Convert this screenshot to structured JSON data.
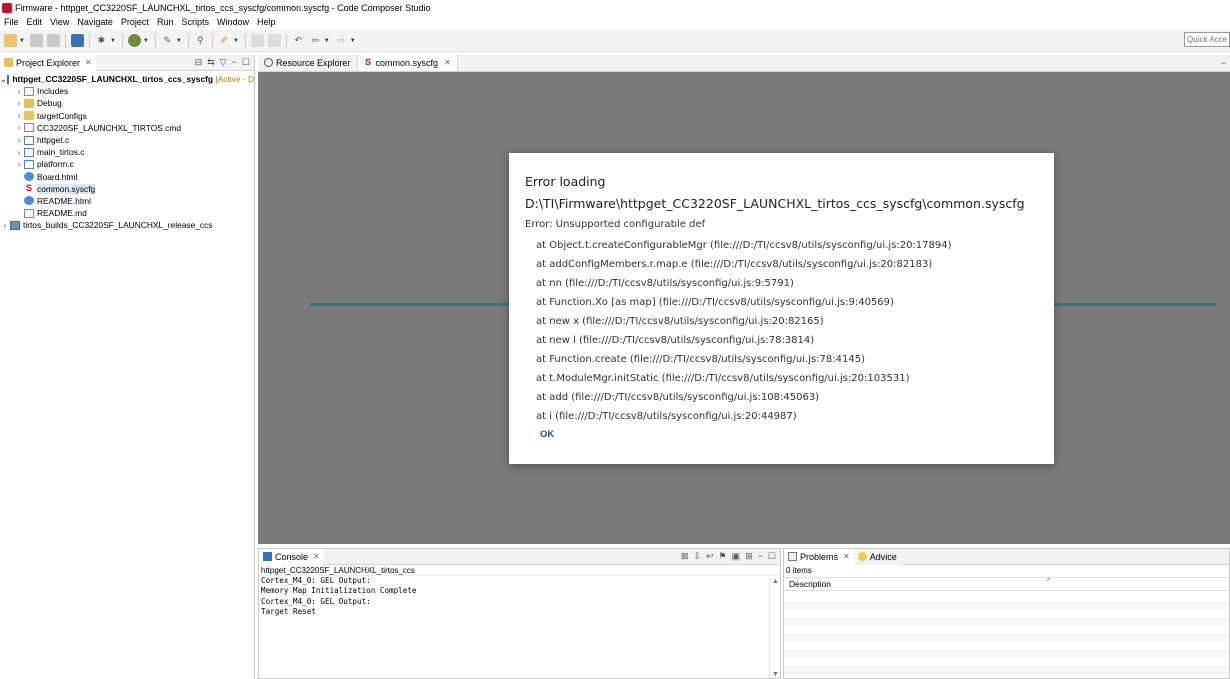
{
  "window": {
    "title": "Firmware - httpget_CC3220SF_LAUNCHXL_tirtos_ccs_syscfg/common.syscfg - Code Composer Studio"
  },
  "menu": [
    "File",
    "Edit",
    "View",
    "Navigate",
    "Project",
    "Run",
    "Scripts",
    "Window",
    "Help"
  ],
  "toolbar": {
    "quick_access_placeholder": "Quick Access"
  },
  "project_explorer": {
    "tab_label": "Project Explorer",
    "root": {
      "name": "httpget_CC3220SF_LAUNCHXL_tirtos_ccs_syscfg",
      "status": "[Active - D"
    },
    "items": [
      {
        "label": "Includes"
      },
      {
        "label": "Debug"
      },
      {
        "label": "targetConfigs"
      },
      {
        "label": "CC3220SF_LAUNCHXL_TIRTOS.cmd"
      },
      {
        "label": "httpget.c"
      },
      {
        "label": "main_tirtos.c"
      },
      {
        "label": "platform.c"
      },
      {
        "label": "Board.html"
      },
      {
        "label": "common.syscfg"
      },
      {
        "label": "README.html"
      },
      {
        "label": "README.md"
      }
    ],
    "second_project": "tirtos_builds_CC3220SF_LAUNCHXL_release_ccs"
  },
  "editor": {
    "tabs": [
      {
        "label": "Resource Explorer"
      },
      {
        "label": "common.syscfg"
      }
    ]
  },
  "dialog": {
    "title_line1": "Error loading",
    "title_line2": "D:\\TI\\Firmware\\httpget_CC3220SF_LAUNCHXL_tirtos_ccs_syscfg\\common.syscfg",
    "error": "Error: Unsupported configurable def",
    "stack": [
      "at Object.t.createConfigurableMgr (file:///D:/TI/ccsv8/utils/sysconfig/ui.js:20:17894)",
      "at addConfigMembers.r.map.e (file:///D:/TI/ccsv8/utils/sysconfig/ui.js:20:82183)",
      "at nn (file:///D:/TI/ccsv8/utils/sysconfig/ui.js:9:5791)",
      "at Function.Xo [as map] (file:///D:/TI/ccsv8/utils/sysconfig/ui.js:9:40569)",
      "at new x (file:///D:/TI/ccsv8/utils/sysconfig/ui.js:20:82165)",
      "at new l (file:///D:/TI/ccsv8/utils/sysconfig/ui.js:78:3814)",
      "at Function.create (file:///D:/TI/ccsv8/utils/sysconfig/ui.js:78:4145)",
      "at t.ModuleMgr.initStatic (file:///D:/TI/ccsv8/utils/sysconfig/ui.js:20:103531)",
      "at add (file:///D:/TI/ccsv8/utils/sysconfig/ui.js:108:45063)",
      "at i (file:///D:/TI/ccsv8/utils/sysconfig/ui.js:20:44987)"
    ],
    "ok_label": "OK"
  },
  "console": {
    "tab_label": "Console",
    "launch": "httpget_CC3220SF_LAUNCHXL_tirtos_ccs",
    "lines": [
      "Cortex_M4_0: GEL Output:",
      "Memory Map Initialization Complete",
      "Cortex_M4_0: GEL Output:",
      "Target Reset"
    ]
  },
  "problems": {
    "tab_label": "Problems",
    "advice_label": "Advice",
    "count": "0 items",
    "column": "Description"
  }
}
